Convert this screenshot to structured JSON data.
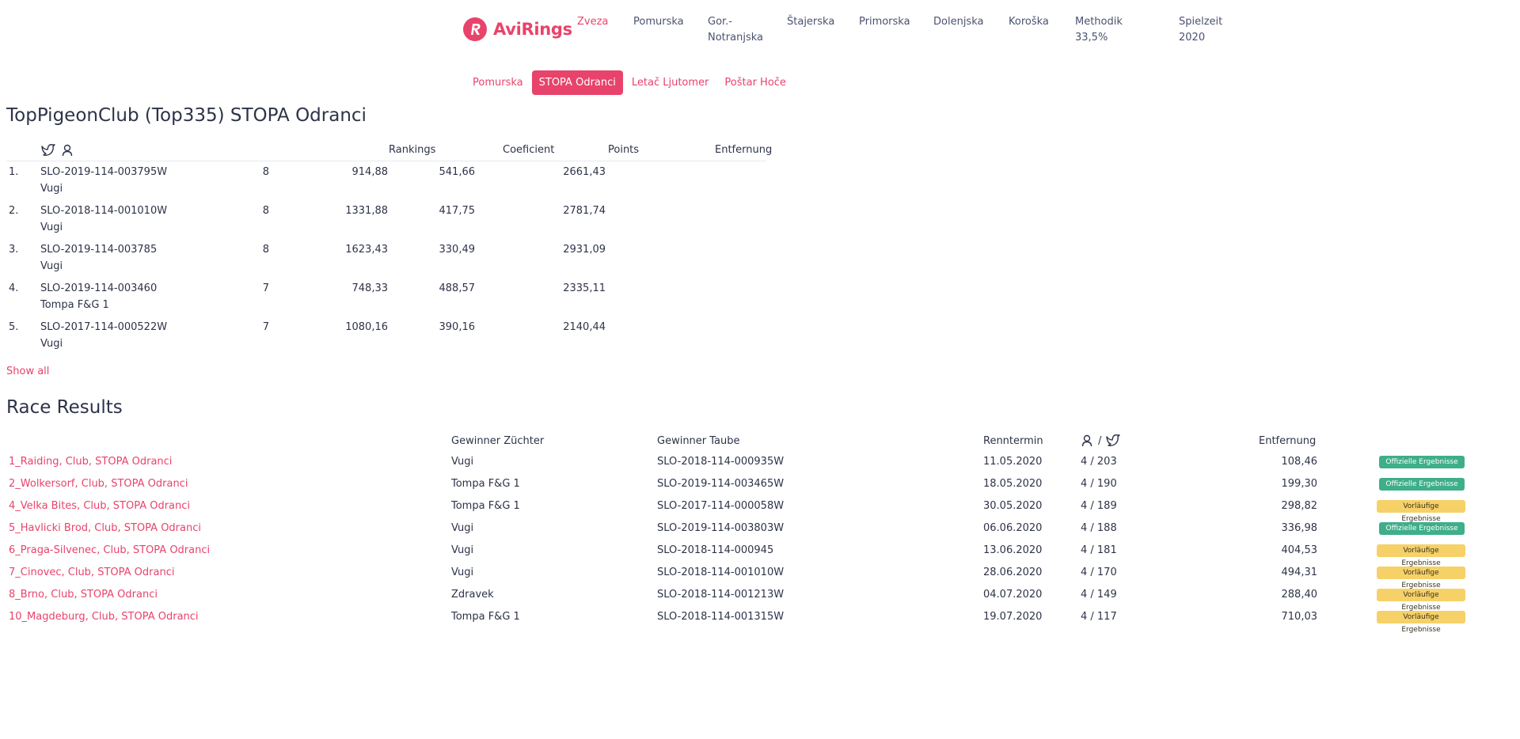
{
  "brand": {
    "name": "AviRings",
    "color": "#e8436b"
  },
  "nav": {
    "items": [
      {
        "label": "Zveza",
        "active": true
      },
      {
        "label": "Pomurska"
      },
      {
        "label": "Gor.-",
        "label2": "Notranjska"
      },
      {
        "label": "Štajerska"
      },
      {
        "label": "Primorska"
      },
      {
        "label": "Dolenjska"
      },
      {
        "label": "Koroška"
      },
      {
        "label": "Methodik 33,5%"
      },
      {
        "label": "Spielzeit 2020"
      }
    ]
  },
  "subnav": {
    "items": [
      {
        "label": "Pomurska"
      },
      {
        "label": "STOPA Odranci",
        "active": true
      },
      {
        "label": "Letač Ljutomer"
      },
      {
        "label": "Poštar Hoče"
      }
    ]
  },
  "rankings": {
    "title": "TopPigeonClub (Top335) STOPA Odranci",
    "columns": {
      "pigeon_icon": "pigeon-icon",
      "user_icon": "user-icon",
      "rankings": "Rankings",
      "coeficient": "Coeficient",
      "points": "Points",
      "entfernung": "Entfernung"
    },
    "rows": [
      {
        "num": "1.",
        "ring": "SLO-2019-114-003795W",
        "name": "Vugi",
        "rankings": "8",
        "coef": "914,88",
        "points": "541,66",
        "dist": "2661,43"
      },
      {
        "num": "2.",
        "ring": "SLO-2018-114-001010W",
        "name": "Vugi",
        "rankings": "8",
        "coef": "1331,88",
        "points": "417,75",
        "dist": "2781,74"
      },
      {
        "num": "3.",
        "ring": "SLO-2019-114-003785",
        "name": "Vugi",
        "rankings": "8",
        "coef": "1623,43",
        "points": "330,49",
        "dist": "2931,09"
      },
      {
        "num": "4.",
        "ring": "SLO-2019-114-003460",
        "name": "Tompa F&G 1",
        "rankings": "7",
        "coef": "748,33",
        "points": "488,57",
        "dist": "2335,11"
      },
      {
        "num": "5.",
        "ring": "SLO-2017-114-000522W",
        "name": "Vugi",
        "rankings": "7",
        "coef": "1080,16",
        "points": "390,16",
        "dist": "2140,44"
      }
    ],
    "show_all": "Show all"
  },
  "race_results": {
    "title": "Race Results",
    "columns": {
      "breeder": "Gewinner Züchter",
      "pigeon": "Gewinner Taube",
      "date": "Renntermin",
      "separator": "/",
      "entfernung": "Entfernung"
    },
    "rows": [
      {
        "race": "1_Raiding, Club, STOPA Odranci",
        "breeder": "Vugi",
        "pigeon": "SLO-2018-114-000935W",
        "date": "11.05.2020",
        "count": "4 / 203",
        "dist": "108,46",
        "status": "Offizielle Ergebnisse",
        "official": true
      },
      {
        "race": "2_Wolkersorf, Club, STOPA Odranci",
        "breeder": "Tompa F&G 1",
        "pigeon": "SLO-2019-114-003465W",
        "date": "18.05.2020",
        "count": "4 / 190",
        "dist": "199,30",
        "status": "Offizielle Ergebnisse",
        "official": true
      },
      {
        "race": "4_Velka Bites, Club, STOPA Odranci",
        "breeder": "Tompa F&G 1",
        "pigeon": "SLO-2017-114-000058W",
        "date": "30.05.2020",
        "count": "4 / 189",
        "dist": "298,82",
        "status": "Vorläufige Ergebnisse",
        "official": false
      },
      {
        "race": "5_Havlicki Brod, Club, STOPA Odranci",
        "breeder": "Vugi",
        "pigeon": "SLO-2019-114-003803W",
        "date": "06.06.2020",
        "count": "4 / 188",
        "dist": "336,98",
        "status": "Offizielle Ergebnisse",
        "official": true
      },
      {
        "race": "6_Praga-Silvenec, Club, STOPA Odranci",
        "breeder": "Vugi",
        "pigeon": "SLO-2018-114-000945",
        "date": "13.06.2020",
        "count": "4 / 181",
        "dist": "404,53",
        "status": "Vorläufige Ergebnisse",
        "official": false
      },
      {
        "race": "7_Cinovec, Club, STOPA Odranci",
        "breeder": "Vugi",
        "pigeon": "SLO-2018-114-001010W",
        "date": "28.06.2020",
        "count": "4 / 170",
        "dist": "494,31",
        "status": "Vorläufige Ergebnisse",
        "official": false
      },
      {
        "race": "8_Brno, Club, STOPA Odranci",
        "breeder": "Zdravek",
        "pigeon": "SLO-2018-114-001213W",
        "date": "04.07.2020",
        "count": "4 / 149",
        "dist": "288,40",
        "status": "Vorläufige Ergebnisse",
        "official": false
      },
      {
        "race": "10_Magdeburg, Club, STOPA Odranci",
        "breeder": "Tompa F&G 1",
        "pigeon": "SLO-2018-114-001315W",
        "date": "19.07.2020",
        "count": "4 / 117",
        "dist": "710,03",
        "status": "Vorläufige Ergebnisse",
        "official": false
      }
    ]
  },
  "colors": {
    "accent": "#e8436b",
    "official": "#3fae8a",
    "preliminary": "#f6d168",
    "text": "#2d3348"
  }
}
